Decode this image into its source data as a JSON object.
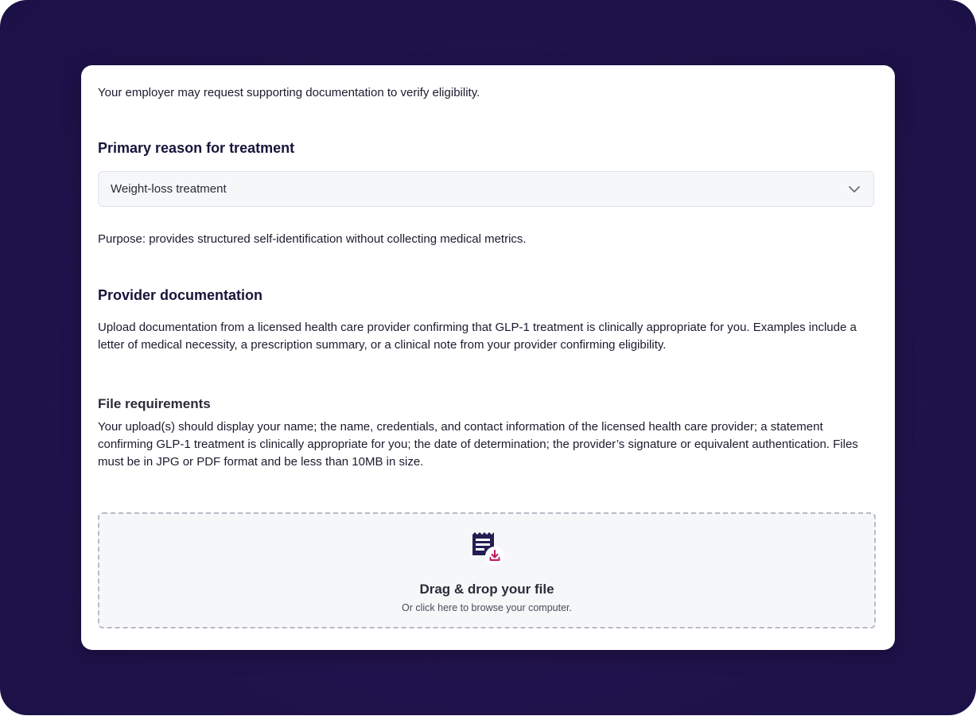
{
  "intro_text": "Your employer may request supporting documentation to verify eligibility.",
  "primary_reason": {
    "heading": "Primary reason for treatment",
    "select_value": "Weight-loss treatment",
    "chevron_icon": "chevron-down-icon",
    "purpose_text": "Purpose: provides structured self-identification without collecting medical metrics."
  },
  "provider_documentation": {
    "heading": "Provider documentation",
    "body": "Upload documentation from a licensed health care provider confirming that GLP-1 treatment is clinically appropriate for you. Examples include a letter of medical necessity, a prescription summary, or a clinical note from your provider confirming eligibility."
  },
  "file_requirements": {
    "heading": "File requirements",
    "body": "Your upload(s) should display your name; the name, credentials, and contact information of the licensed health care provider; a statement confirming GLP-1 treatment is clinically appropriate for you; the date of determination; the provider’s signature or equivalent authentication. Files must be in JPG or PDF format and be less than 10MB in size."
  },
  "dropzone": {
    "icon": "document-download-icon",
    "title": "Drag & drop your file",
    "subtitle": "Or click here to browse your computer."
  },
  "colors": {
    "background": "#22134d",
    "heading": "#17153a",
    "icon_primary": "#231d52",
    "icon_accent": "#c2185b"
  }
}
